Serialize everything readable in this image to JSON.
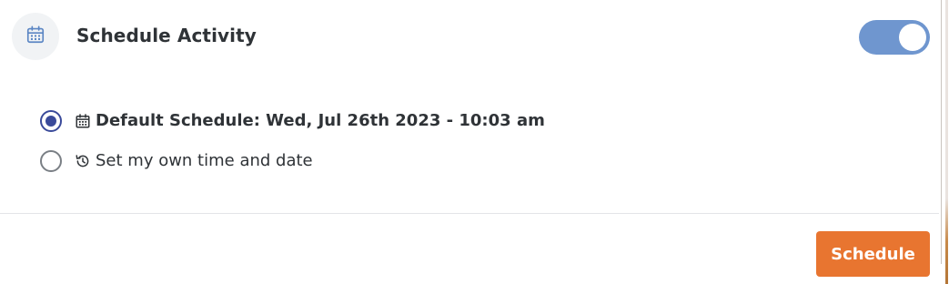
{
  "header": {
    "title": "Schedule Activity",
    "icon": "calendar-icon",
    "toggle_on": true,
    "toggle_color": "#6f96cf"
  },
  "options": [
    {
      "label": "Default Schedule: Wed, Jul 26th 2023 - 10:03 am",
      "icon": "calendar-icon",
      "selected": true
    },
    {
      "label": "Set my own time and date",
      "icon": "history-clock-icon",
      "selected": false
    }
  ],
  "footer": {
    "schedule_label": "Schedule",
    "button_color": "#e87530"
  },
  "colors": {
    "radio_selected": "#3a4a9a",
    "text": "#2f3337"
  }
}
